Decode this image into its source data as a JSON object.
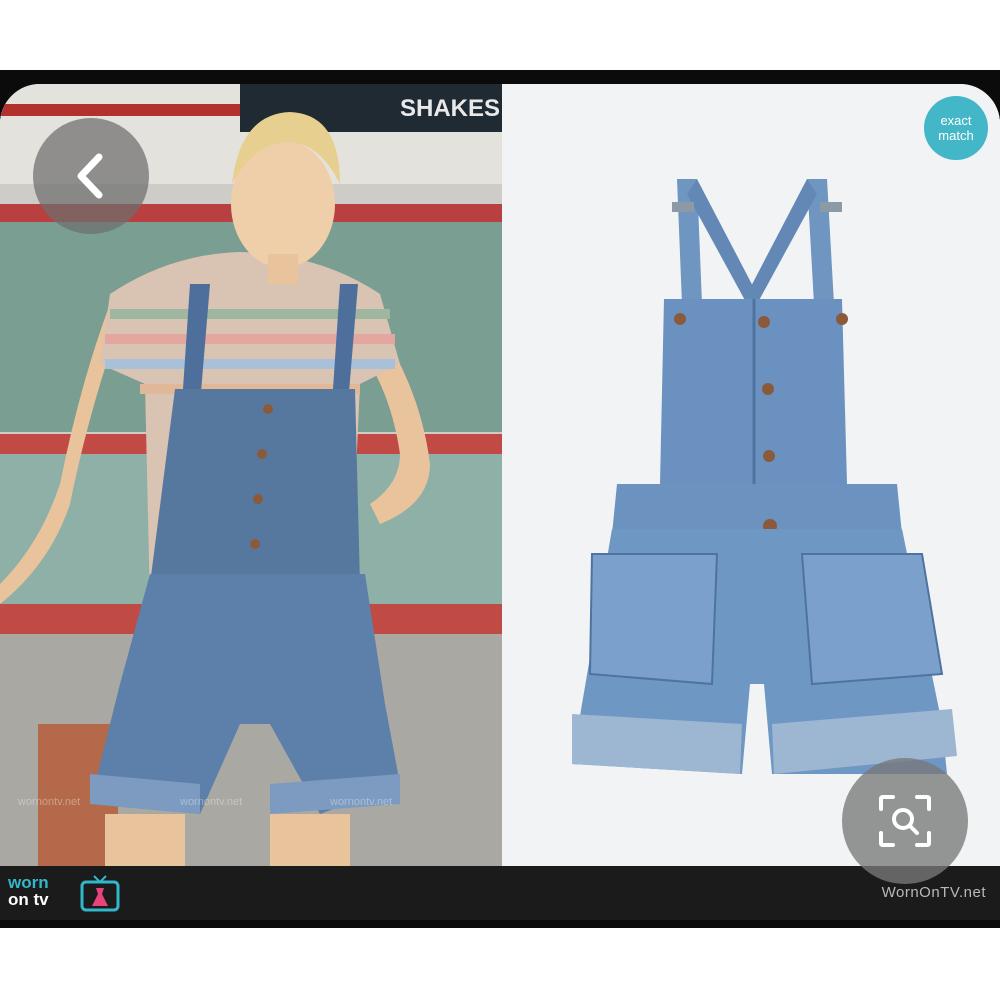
{
  "overlay": {
    "back_icon": "chevron-left-icon",
    "badge_line1": "exact",
    "badge_line2": "match",
    "lens_icon": "visual-search-icon"
  },
  "scene": {
    "sign_text": "SHAKES",
    "watermark": "wornontv.net"
  },
  "footer": {
    "logo_line1": "worn",
    "logo_line2": "on tv",
    "site": "WornOnTV.net"
  },
  "colors": {
    "accent": "#43b7c7",
    "denim": "#5f86b4",
    "footer_bg": "#1b1b1b"
  }
}
